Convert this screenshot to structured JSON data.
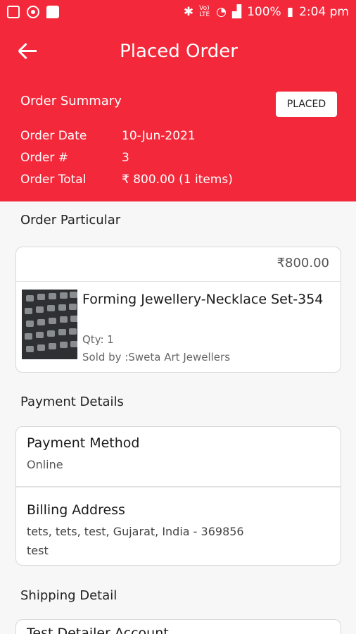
{
  "status_bar": {
    "icons_left": [
      "image-icon",
      "record-icon",
      "message-icon"
    ],
    "network_tag": "Vo) LTE",
    "battery": "100%",
    "time": "2:04 pm"
  },
  "header": {
    "title": "Placed Order",
    "summary_title": "Order Summary",
    "status_badge": "PLACED",
    "rows": [
      {
        "label": "Order Date",
        "value": "10-Jun-2021"
      },
      {
        "label": "Order #",
        "value": "3"
      },
      {
        "label": "Order Total",
        "value": "₹ 800.00 (1 items)"
      }
    ]
  },
  "order_particular": {
    "section_title": "Order Particular",
    "price": "₹800.00",
    "product_name": "Forming Jewellery-Necklace Set-354",
    "qty": "Qty: 1",
    "seller": "Sold by :Sweta Art Jewellers"
  },
  "payment": {
    "section_title": "Payment Details",
    "method_label": "Payment Method",
    "method_value": "Online",
    "billing_label": "Billing Address",
    "billing_line1": "tets, tets, test, Gujarat, India - 369856",
    "billing_line2": "test"
  },
  "shipping": {
    "section_title": "Shipping Detail",
    "partial_text": "Test Detailer Account"
  },
  "colors": {
    "primary": "#f3283a",
    "background": "#f7f7f7"
  }
}
